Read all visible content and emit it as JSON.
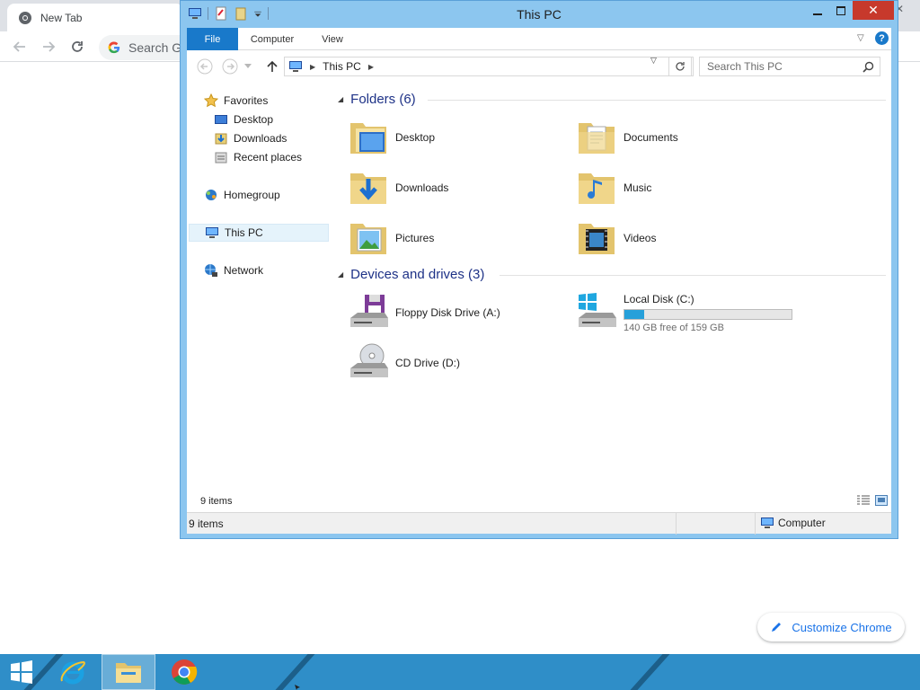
{
  "chrome": {
    "tab_title": "New Tab",
    "omnibox_placeholder": "Search Go",
    "customize_label": "Customize Chrome",
    "accent_color": "#1a73e8"
  },
  "window": {
    "title": "This PC",
    "close_glyph": "✕",
    "ribbon": {
      "tabs": [
        "File",
        "Computer",
        "View"
      ],
      "help": "?"
    },
    "address": {
      "crumbs": [
        "This PC"
      ],
      "search_placeholder": "Search This PC"
    },
    "nav": {
      "favorites": "Favorites",
      "desktop": "Desktop",
      "downloads": "Downloads",
      "recent": "Recent places",
      "homegroup": "Homegroup",
      "this_pc": "This PC",
      "network": "Network"
    },
    "folders_header": "Folders (6)",
    "folders": [
      "Desktop",
      "Documents",
      "Downloads",
      "Music",
      "Pictures",
      "Videos"
    ],
    "devices_header": "Devices and drives (3)",
    "devices": {
      "floppy": "Floppy Disk Drive (A:)",
      "local": "Local Disk (C:)",
      "local_free": "140 GB free of 159 GB",
      "local_used_fraction": 0.12,
      "cd": "CD Drive (D:)"
    },
    "inner_status": "9 items",
    "status_left": "9 items",
    "status_right": "Computer"
  },
  "taskbar": {
    "apps": [
      "start-icon",
      "internet-explorer-icon",
      "file-explorer-icon",
      "chrome-icon"
    ],
    "color": "#2f8ec8"
  }
}
